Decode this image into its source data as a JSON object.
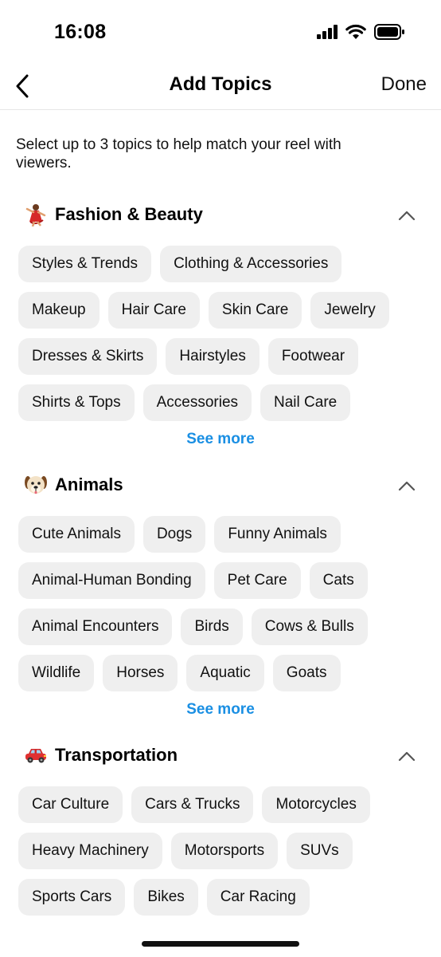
{
  "status": {
    "time": "16:08"
  },
  "nav": {
    "title": "Add Topics",
    "done_label": "Done"
  },
  "intro": "Select up to 3 topics to help match your reel with viewers.",
  "sections": [
    {
      "title": "Fashion & Beauty",
      "icon": "dancer-emoji-icon",
      "rows": [
        [
          "Styles & Trends",
          "Clothing & Accessories"
        ],
        [
          "Makeup",
          "Hair Care",
          "Skin Care",
          "Jewelry"
        ],
        [
          "Dresses & Skirts",
          "Hairstyles",
          "Footwear"
        ],
        [
          "Shirts & Tops",
          "Accessories",
          "Nail Care"
        ]
      ],
      "see_more": "See more"
    },
    {
      "title": "Animals",
      "icon": "dog-face-emoji-icon",
      "rows": [
        [
          "Cute Animals",
          "Dogs",
          "Funny Animals"
        ],
        [
          "Animal-Human Bonding",
          "Pet Care",
          "Cats"
        ],
        [
          "Animal Encounters",
          "Birds",
          "Cows & Bulls"
        ],
        [
          "Wildlife",
          "Horses",
          "Aquatic",
          "Goats"
        ]
      ],
      "see_more": "See more"
    },
    {
      "title": "Transportation",
      "icon": "car-emoji-icon",
      "rows": [
        [
          "Car Culture",
          "Cars & Trucks",
          "Motorcycles"
        ],
        [
          "Heavy Machinery",
          "Motorsports",
          "SUVs"
        ],
        [
          "Sports Cars",
          "Bikes",
          "Car Racing"
        ]
      ]
    }
  ]
}
